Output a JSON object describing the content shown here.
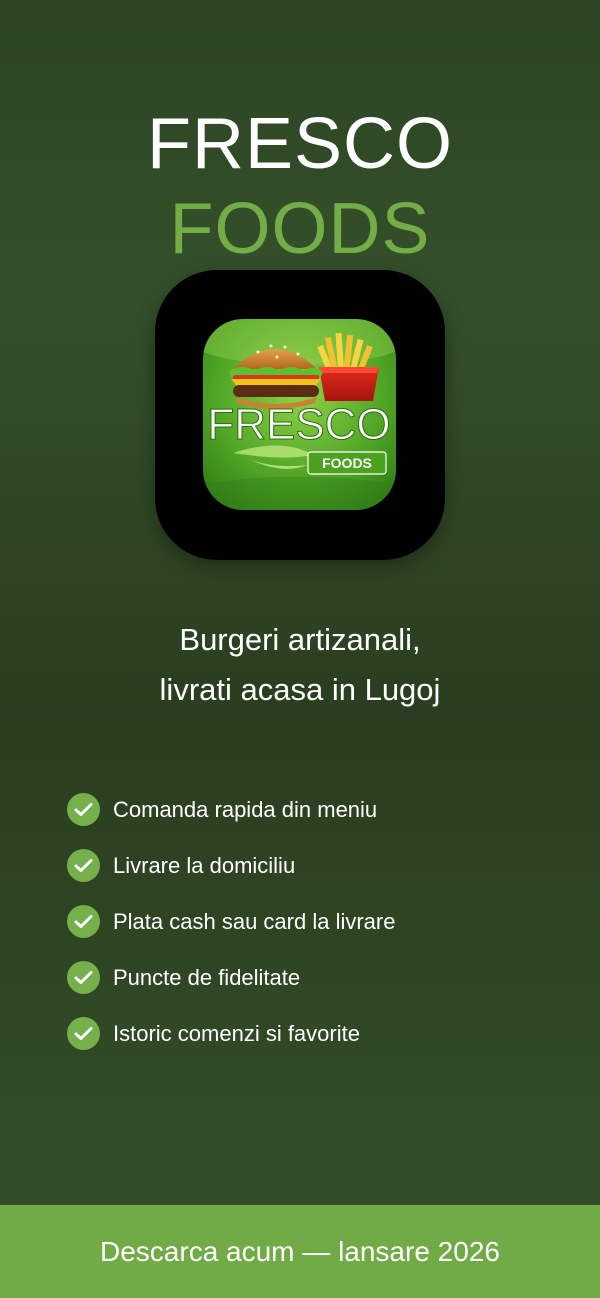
{
  "brand": {
    "line1": "FRESCO",
    "line2": "FOODS",
    "line1_color": "#ffffff",
    "line2_color": "#72ad48"
  },
  "app_icon": {
    "logo_main": "FRESCO",
    "logo_badge": "FOODS",
    "icon_names": [
      "burger-icon",
      "fries-icon",
      "leaf-icon"
    ]
  },
  "tagline": {
    "line1": "Burgeri artizanali,",
    "line2": "livrati acasa in Lugoj"
  },
  "features": [
    {
      "label": "Comanda rapida din meniu",
      "icon": "check-circle-icon"
    },
    {
      "label": "Livrare la domiciliu",
      "icon": "check-circle-icon"
    },
    {
      "label": "Plata cash sau card la livrare",
      "icon": "check-circle-icon"
    },
    {
      "label": "Puncte de fidelitate",
      "icon": "check-circle-icon"
    },
    {
      "label": "Istoric comenzi si favorite",
      "icon": "check-circle-icon"
    }
  ],
  "footer": {
    "cta": "Descarca acum — lansare 2026"
  },
  "colors": {
    "background": "#2c4423",
    "accent": "#72ad48",
    "footer_bar": "#70ab45",
    "check": "#76b04a"
  }
}
